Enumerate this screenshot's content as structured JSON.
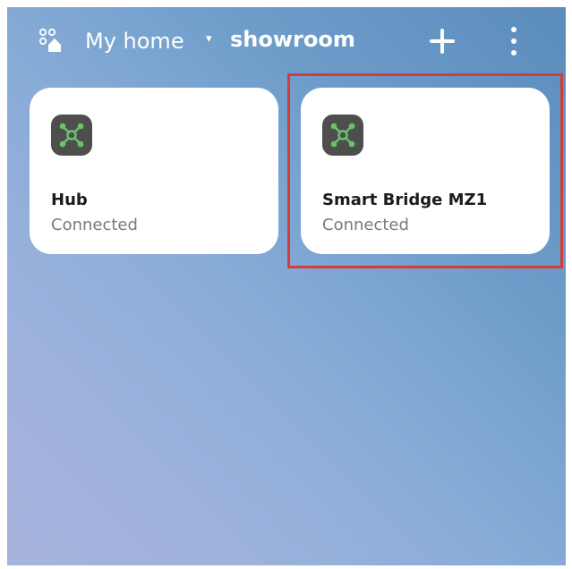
{
  "header": {
    "home_name": "My home",
    "home_caret": "▾",
    "room_name": "showroom",
    "icons": [
      "home-grid-icon",
      "add-icon",
      "more-vertical-icon"
    ]
  },
  "devices": [
    {
      "name": "Hub",
      "status": "Connected",
      "icon": "hub-network-icon"
    },
    {
      "name": "Smart Bridge MZ1",
      "status": "Connected",
      "icon": "hub-network-icon"
    }
  ],
  "colors": {
    "device_icon_bg": "#4d4f4f",
    "device_icon_fg": "#6cc26c",
    "highlight": "#d43c3c",
    "status_text": "#7a7a7a"
  }
}
